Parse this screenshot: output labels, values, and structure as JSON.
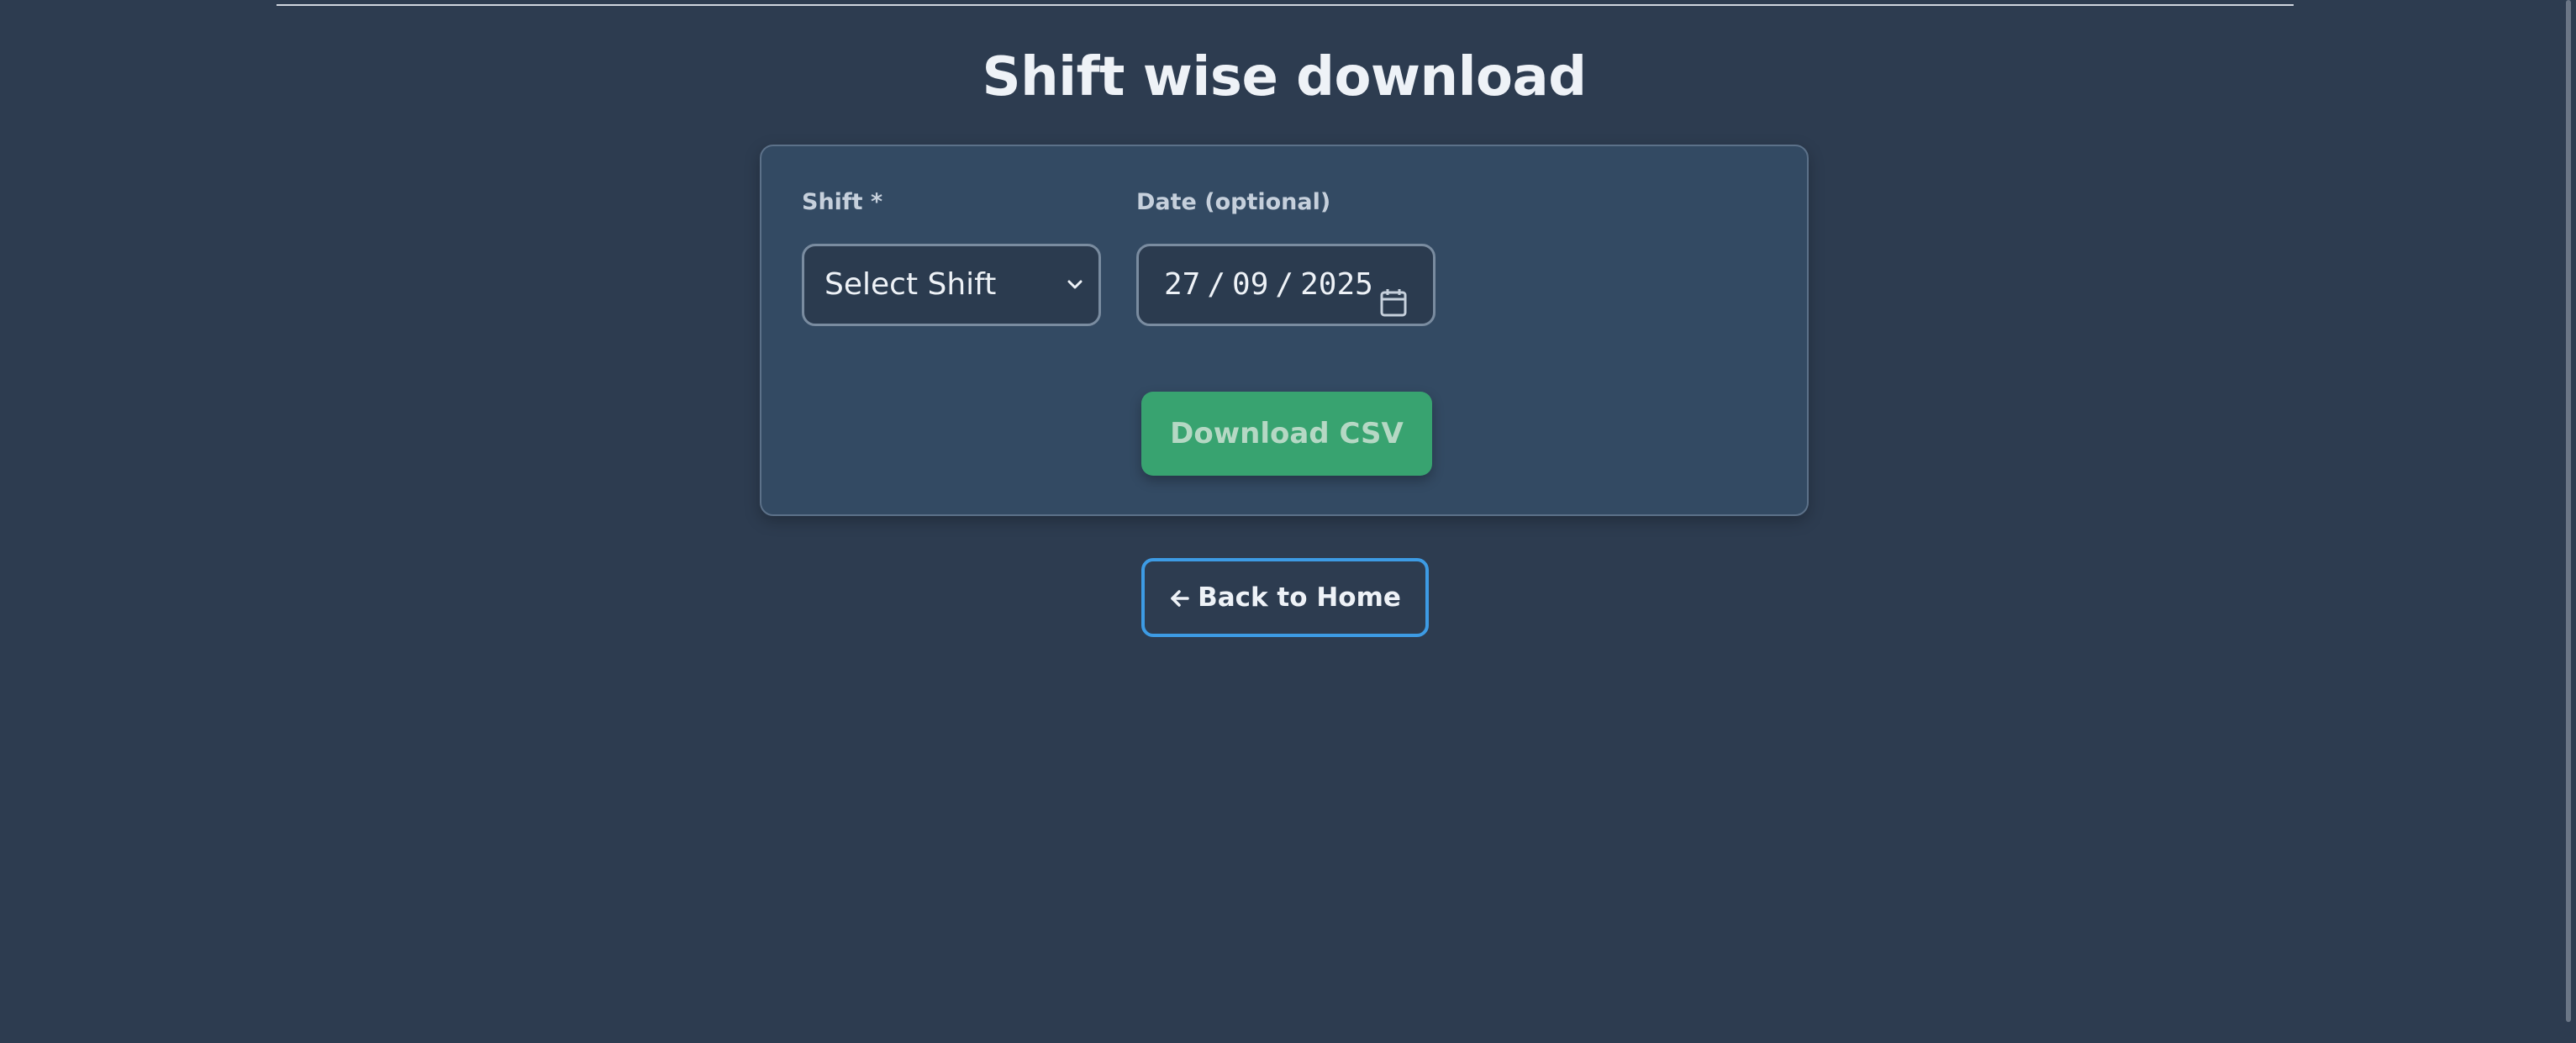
{
  "page": {
    "title": "Shift wise download"
  },
  "form": {
    "shift_label": "Shift *",
    "shift_select_value": "Select Shift",
    "date_label": "Date (optional)",
    "date_day": "27",
    "date_month": "09",
    "date_year": "2025",
    "date_separator": "/",
    "download_label": "Download CSV"
  },
  "nav": {
    "back_arrow": "🡐",
    "back_label": "Back to Home"
  },
  "icons": {
    "select_chevron": "chevron-down-icon",
    "date_picker": "calendar-icon",
    "back": "arrow-left-icon"
  },
  "colors": {
    "background": "#2d3c50",
    "card": "#334a63",
    "download_button": "#38a370",
    "back_button_border": "#3d9be4"
  }
}
